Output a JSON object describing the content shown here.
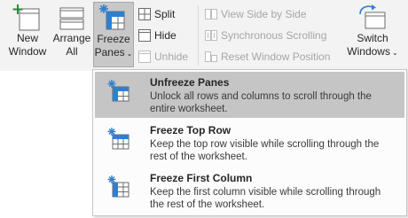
{
  "ribbon": {
    "new_window": {
      "line1": "New",
      "line2": "Window"
    },
    "arrange_all": {
      "line1": "Arrange",
      "line2": "All"
    },
    "freeze_panes": {
      "line1": "Freeze",
      "line2": "Panes",
      "chevron": "⌄"
    },
    "split": "Split",
    "hide": "Hide",
    "unhide": "Unhide",
    "view_side_by_side": "View Side by Side",
    "synchronous_scrolling": "Synchronous Scrolling",
    "reset_window_position": "Reset Window Position",
    "switch_windows": {
      "line1": "Switch",
      "line2": "Windows",
      "chevron": "⌄"
    }
  },
  "menu": {
    "items": [
      {
        "title": "Unfreeze Panes",
        "description": "Unlock all rows and columns to scroll through the entire worksheet."
      },
      {
        "title": "Freeze Top Row",
        "description": "Keep the top row visible while scrolling through the rest of the worksheet."
      },
      {
        "title": "Freeze First Column",
        "description": "Keep the first column visible while scrolling through the rest of the worksheet."
      }
    ]
  },
  "colors": {
    "accent": "#2f7fd0",
    "active_button": "#c8c8c8",
    "highlight": "#c5c5c5"
  }
}
